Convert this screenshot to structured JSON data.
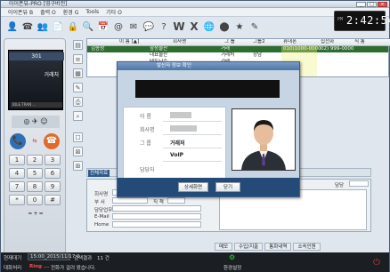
{
  "window": {
    "title": "아이폰뷰-PRO [영구버전]"
  },
  "menubar": {
    "items": [
      "아이폰뷰 B",
      "출력 O",
      "환경 G",
      "Tools",
      "기타 O"
    ]
  },
  "clock": {
    "ampm": "PM",
    "time": "2:42:54"
  },
  "phone": {
    "line": "301",
    "screen_label": "거래처",
    "status": "IDLE  TRAN  ..."
  },
  "keypad": [
    "1",
    "2",
    "3",
    "4",
    "5",
    "6",
    "7",
    "8",
    "9",
    "*",
    "0",
    "#"
  ],
  "grid": {
    "headers": [
      "이 름 [▲]",
      "회사명",
      "그 룹",
      "그룹2",
      "휴대폰",
      "집전화",
      "직 통"
    ],
    "rows": [
      [
        "김송성",
        "삼성물산",
        "거래",
        "",
        "010)1000-0000",
        "02) 999-0000",
        ""
      ],
      [
        "",
        "대표물산",
        "거래처",
        "상담",
        "",
        "",
        ""
      ],
      [
        "",
        "테토니스",
        "거래",
        "",
        "",
        "",
        ""
      ]
    ]
  },
  "tabs": {
    "active": "전체자료"
  },
  "detail": {
    "labels": [
      "회사명",
      "부 서",
      "담당업무",
      "E-Mail",
      "Home"
    ],
    "jikchaek": "직 책",
    "damdang": "담당"
  },
  "bottomtabs": [
    "메모",
    "수입/지출",
    "통화내역",
    "소속인원"
  ],
  "statusbar": {
    "left1": "현재대기",
    "date": "15:00_2015/11/17 0",
    "seg": "검색결과",
    "count": "11 건",
    "left2": "대화처리",
    "ring": "Ring ...",
    "msg": "전화가 걸려 왔습니다.",
    "env": "환경설정"
  },
  "modal": {
    "title": "발신자 정보 확인",
    "fields": [
      {
        "label": "이    름",
        "value": ""
      },
      {
        "label": "회사명",
        "value": ""
      },
      {
        "label": "그    룹",
        "value": "거래처"
      },
      {
        "label": "",
        "value": "VoIP"
      },
      {
        "label": "담당자",
        "value": ""
      }
    ],
    "btn_detail": "상세화면",
    "btn_close": "닫기"
  },
  "colors": {
    "accent": "#2d5a8c",
    "selected_row": "#2f6c2f",
    "modal_footer": "#244a78"
  }
}
